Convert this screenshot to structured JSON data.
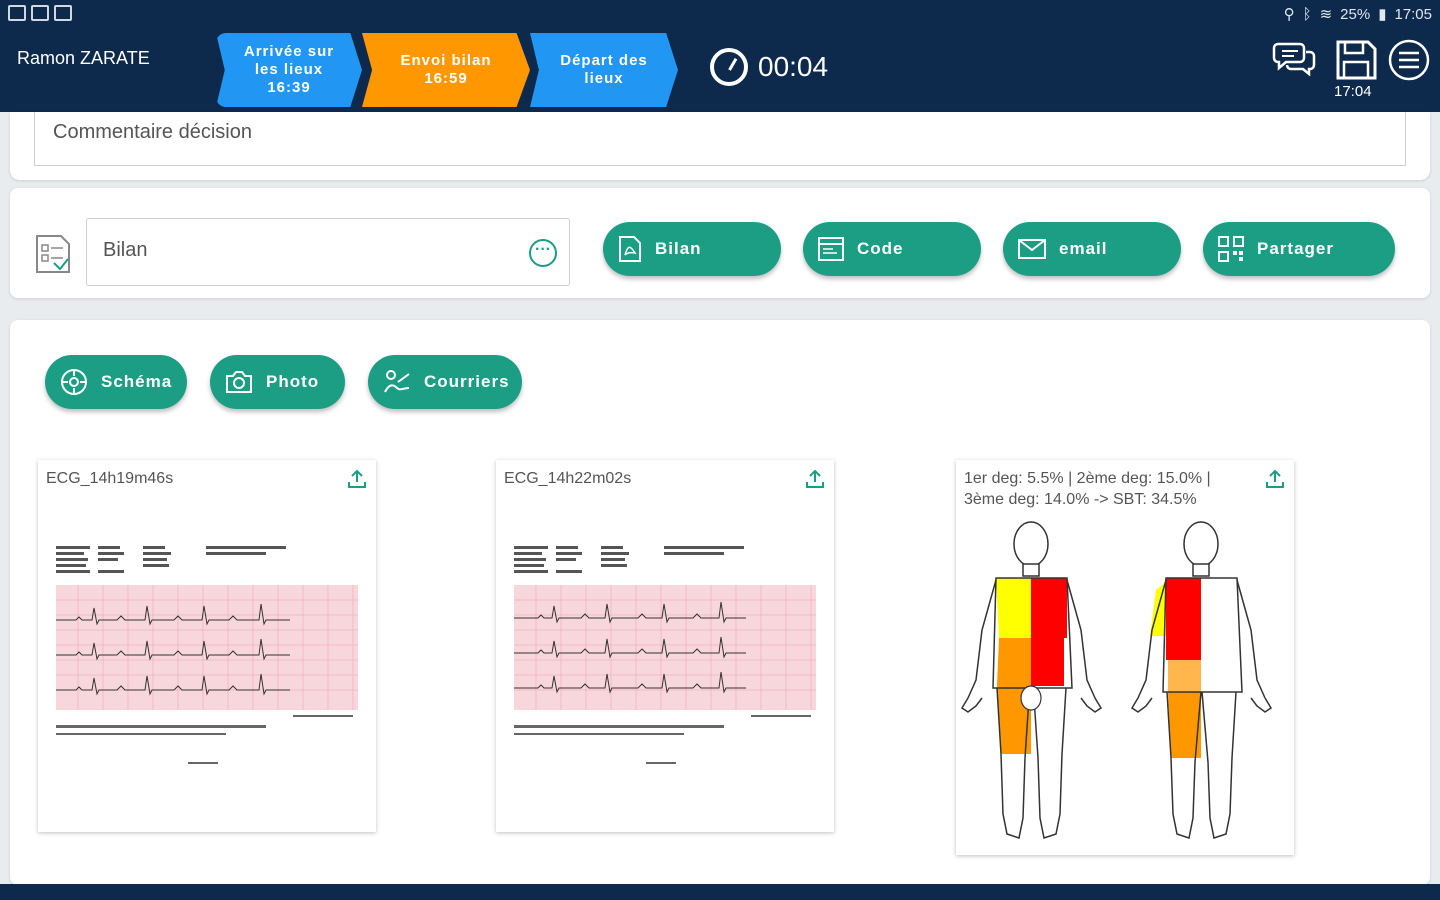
{
  "status_bar": {
    "battery": "25%",
    "time": "17:05"
  },
  "header": {
    "patient_name": "Ramon ZARATE",
    "steps": [
      {
        "label": "Arrivée sur les lieux",
        "time": "16:39",
        "color": "#2196f3"
      },
      {
        "label": "Envoi bilan",
        "time": "16:59",
        "color": "#ff9800"
      },
      {
        "label": "Départ des lieux",
        "time": "",
        "color": "#2196f3"
      }
    ],
    "timer": "00:04",
    "save_time": "17:04",
    "icons": [
      "chat-icon",
      "save-icon",
      "menu-icon"
    ]
  },
  "decision": {
    "comment_placeholder": "Commentaire décision"
  },
  "bilan": {
    "input_value": "Bilan",
    "buttons": [
      {
        "label": "Bilan",
        "icon": "pdf-icon"
      },
      {
        "label": "Code",
        "icon": "code-icon"
      },
      {
        "label": "email",
        "icon": "email-icon"
      },
      {
        "label": "Partager",
        "icon": "qr-icon"
      }
    ]
  },
  "media": {
    "buttons": [
      {
        "label": "Schéma",
        "icon": "schema-icon"
      },
      {
        "label": "Photo",
        "icon": "camera-icon"
      },
      {
        "label": "Courriers",
        "icon": "signature-icon"
      }
    ],
    "thumbnails": [
      {
        "title": "ECG_14h19m46s"
      },
      {
        "title": "ECG_14h22m02s"
      },
      {
        "title_line1": "1er deg: 5.5% | 2ème deg: 15.0% |",
        "title_line2": "3ème deg: 14.0% -> SBT: 34.5%"
      }
    ]
  },
  "colors": {
    "navy": "#0d2a4d",
    "teal": "#1b9e84",
    "blue": "#2196f3",
    "orange": "#ff9800",
    "burn_1st": "#ffff00",
    "burn_2nd": "#ff9800",
    "burn_3rd": "#ff0000"
  }
}
